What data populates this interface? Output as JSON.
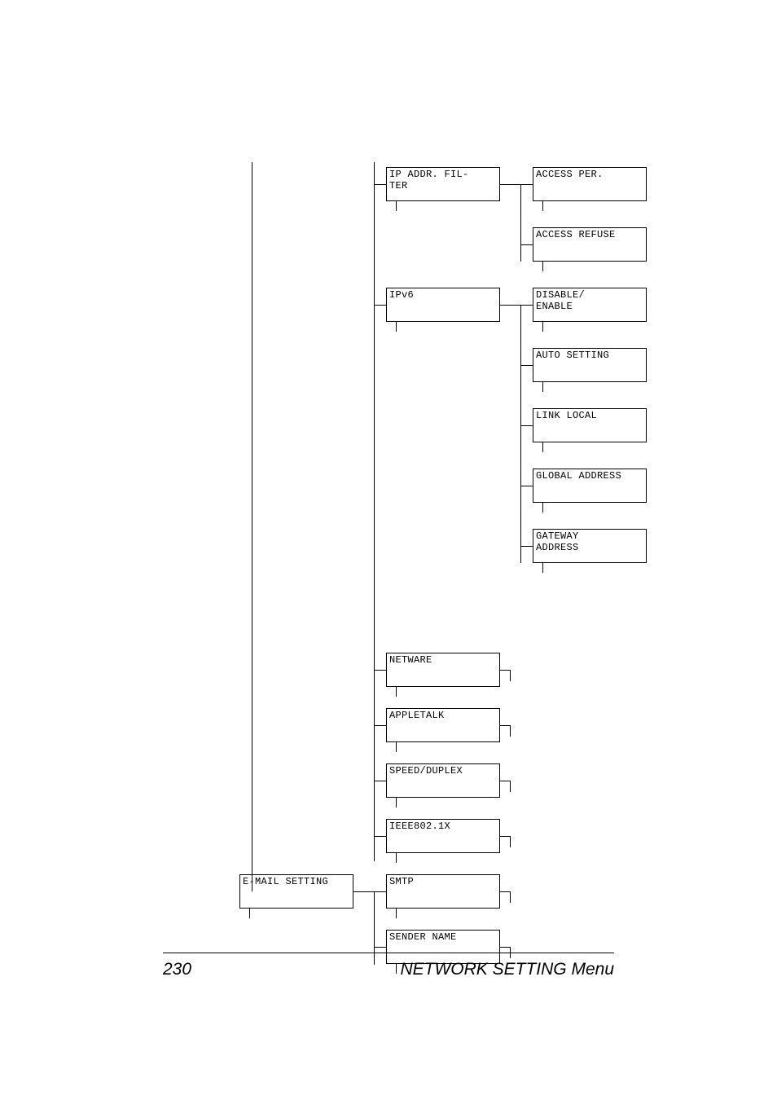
{
  "footer": {
    "page_number": "230",
    "title": "NETWORK SETTING Menu"
  },
  "col1": {
    "email": "E-MAIL SETTING"
  },
  "col2": {
    "ip_filter": "IP ADDR. FIL-\nTER",
    "ipv6": "IPv6",
    "netware": "NETWARE",
    "appletalk": "APPLETALK",
    "speed_duplex": "SPEED/DUPLEX",
    "ieee": "IEEE802.1X",
    "smtp": "SMTP",
    "sender_name": "SENDER NAME"
  },
  "col3": {
    "access_per": "ACCESS PER.",
    "access_refuse": "ACCESS REFUSE",
    "disable_enable": "DISABLE/\nENABLE",
    "auto_setting": "AUTO SETTING",
    "link_local": "LINK LOCAL",
    "global_address": "GLOBAL ADDRESS",
    "gateway_address": "GATEWAY\nADDRESS"
  }
}
